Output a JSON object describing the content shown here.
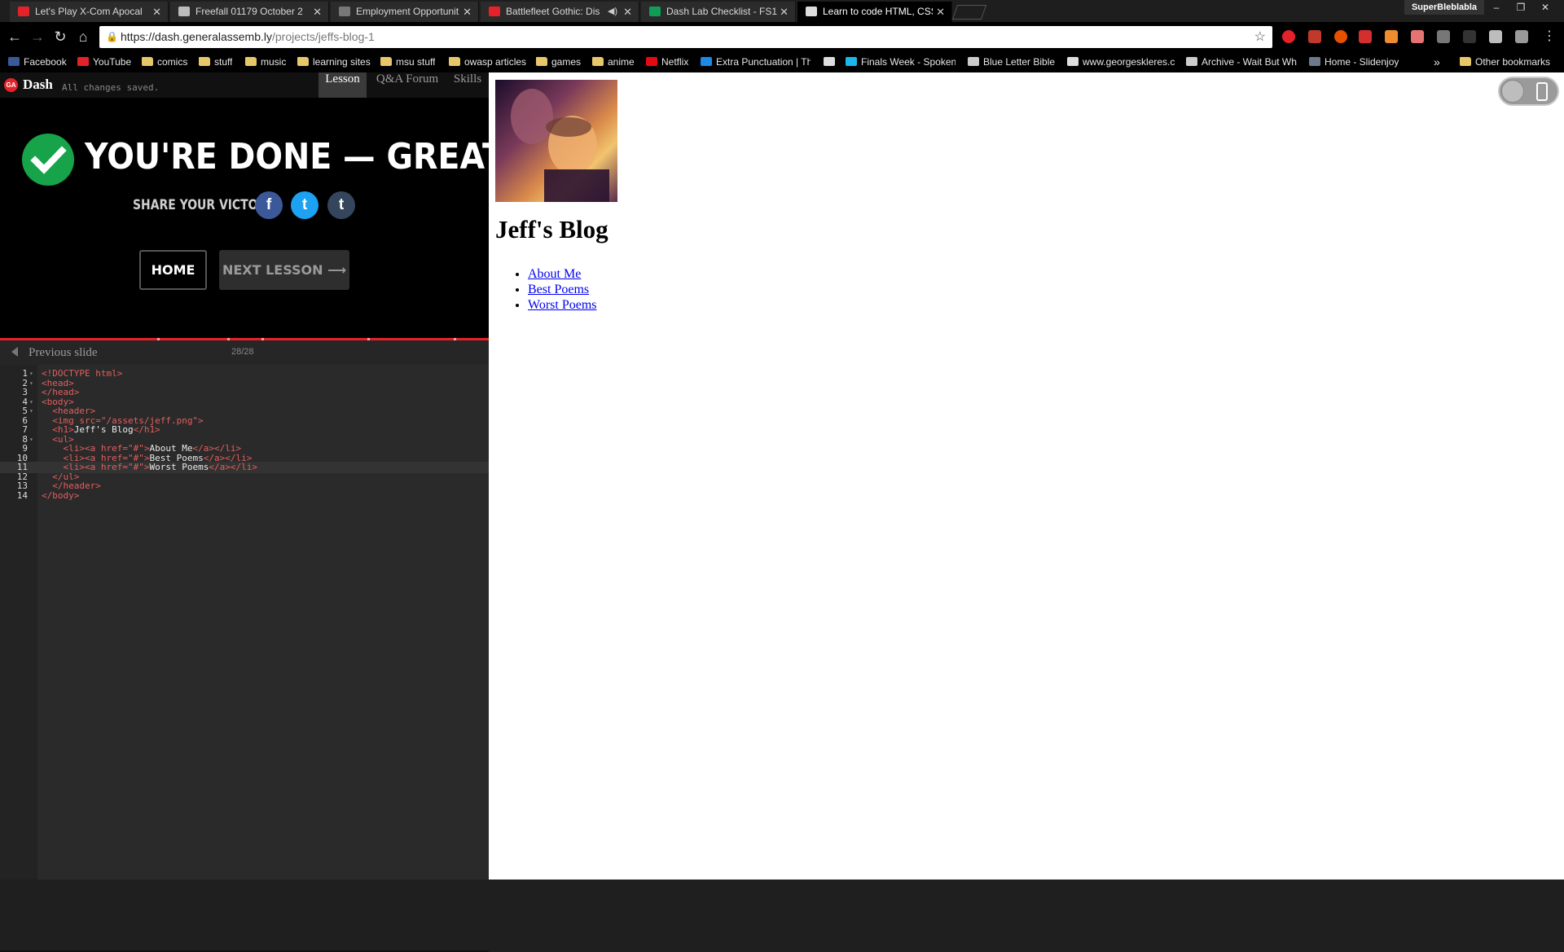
{
  "browser": {
    "tabs": [
      {
        "title": "Let's Play X-Com Apocal",
        "icon_color": "#e52229",
        "active": false
      },
      {
        "title": "Freefall 01179 October 2",
        "icon_color": "#bbbbbb",
        "active": false
      },
      {
        "title": "Employment Opportunit",
        "icon_color": "#777777",
        "active": false
      },
      {
        "title": "Battlefleet Gothic: Dis",
        "icon_color": "#e52229",
        "active": false
      },
      {
        "title": "Dash Lab Checklist - FS1",
        "icon_color": "#0f9d58",
        "active": false
      },
      {
        "title": "Learn to code HTML, CSS",
        "icon_color": "#dddddd",
        "active": true
      }
    ],
    "profile": "SuperBleblabla",
    "window_controls": [
      "–",
      "❐",
      "✕"
    ],
    "nav": {
      "back": "←",
      "forward": "→",
      "reload": "↻",
      "home": "⌂"
    },
    "url_host": "https://dash.generalassemb.ly",
    "url_path": "/projects/jeffs-blog-1",
    "star": "☆",
    "bookmarks": [
      {
        "label": "Facebook",
        "icon": "#3b5998"
      },
      {
        "label": "YouTube",
        "icon": "#e52229"
      },
      {
        "label": "comics",
        "icon": "folder"
      },
      {
        "label": "stuff",
        "icon": "folder"
      },
      {
        "label": "music",
        "icon": "folder"
      },
      {
        "label": "learning sites",
        "icon": "folder"
      },
      {
        "label": "msu stuff",
        "icon": "folder"
      },
      {
        "label": "owasp articles",
        "icon": "folder"
      },
      {
        "label": "games",
        "icon": "folder"
      },
      {
        "label": "anime",
        "icon": "folder"
      },
      {
        "label": "Netflix",
        "icon": "#e50914"
      },
      {
        "label": "Extra Punctuation | Th",
        "icon": "#1e88e5"
      },
      {
        "label": "",
        "icon": "#dddddd"
      },
      {
        "label": "Finals Week - Spoken",
        "icon": "#1ab7ea"
      },
      {
        "label": "Blue Letter Bible",
        "icon": "#cccccc"
      },
      {
        "label": "www.georgeskleres.c",
        "icon": "#dddddd"
      },
      {
        "label": "Archive - Wait But Wh",
        "icon": "#cccccc"
      },
      {
        "label": "Home - Slidenjoy",
        "icon": "#6c7a89"
      }
    ],
    "more_bookmarks": "»",
    "other_bookmarks": "Other bookmarks"
  },
  "dash": {
    "logo": "GA",
    "title": "Dash",
    "saved_status": "All changes saved.",
    "tabs": [
      "Lesson",
      "Q&A Forum",
      "Skills"
    ],
    "done_message": "YOU'RE DONE — GREAT JOB!",
    "share_label": "SHARE YOUR VICTORY:",
    "share": {
      "facebook": "f",
      "twitter": "t",
      "tumblr": "t"
    },
    "home_button": "HOME",
    "next_button": "NEXT LESSON ⟶",
    "previous_slide": "Previous slide",
    "slide_counter": "28/28",
    "progress": 1.0
  },
  "code_lines": [
    {
      "n": "1",
      "fold": "▾",
      "text": "<!DOCTYPE html>"
    },
    {
      "n": "2",
      "fold": "▾",
      "text": "<head>"
    },
    {
      "n": "3",
      "fold": "",
      "text": "</head>"
    },
    {
      "n": "4",
      "fold": "▾",
      "text": "<body>"
    },
    {
      "n": "5",
      "fold": "▾",
      "text": "  <header>"
    },
    {
      "n": "6",
      "fold": "",
      "text": "  <img src=\"/assets/jeff.png\">"
    },
    {
      "n": "7",
      "fold": "",
      "text": "  <h1>Jeff's Blog</h1>"
    },
    {
      "n": "8",
      "fold": "▾",
      "text": "  <ul>"
    },
    {
      "n": "9",
      "fold": "",
      "text": "    <li><a href=\"#\">About Me</a></li>"
    },
    {
      "n": "10",
      "fold": "",
      "text": "    <li><a href=\"#\">Best Poems</a></li>"
    },
    {
      "n": "11",
      "fold": "",
      "text": "    <li><a href=\"#\">Worst Poems</a></li>"
    },
    {
      "n": "12",
      "fold": "",
      "text": "  </ul>"
    },
    {
      "n": "13",
      "fold": "",
      "text": "  </header>"
    },
    {
      "n": "14",
      "fold": "",
      "text": "</body>"
    }
  ],
  "preview": {
    "heading": "Jeff's Blog",
    "links": [
      "About Me",
      "Best Poems",
      "Worst Poems"
    ]
  }
}
